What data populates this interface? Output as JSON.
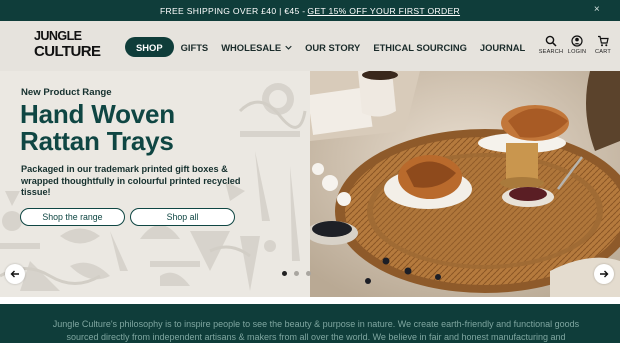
{
  "announcement": {
    "text": "FREE SHIPPING OVER £40 | €45 - ",
    "link": "GET 15% OFF YOUR FIRST ORDER",
    "close_glyph": "×"
  },
  "brand": {
    "logo_line1": "JUNGLE",
    "logo_line2": "CULTURE"
  },
  "nav": {
    "items": [
      {
        "label": "SHOP"
      },
      {
        "label": "GIFTS"
      },
      {
        "label": "WHOLESALE"
      },
      {
        "label": "OUR STORY"
      },
      {
        "label": "ETHICAL SOURCING"
      },
      {
        "label": "JOURNAL"
      }
    ]
  },
  "tools": {
    "search": "SEARCH",
    "login": "LOGIN",
    "cart": "CART",
    "cart_count": "0"
  },
  "hero": {
    "eyebrow": "New Product Range",
    "headline_line1": "Hand Woven",
    "headline_line2": "Rattan Trays",
    "subtext": "Packaged in our trademark printed gift boxes & wrapped thoughtfully in colourful printed recycled tissue!",
    "cta_primary": "Shop the range",
    "cta_secondary": "Shop all",
    "slides_total": 3,
    "slide_active": 1
  },
  "philosophy": {
    "text": "Jungle Culture's philosophy is to inspire people to see the beauty & purpose in nature. We create earth-friendly and functional goods sourced directly from independent artisans & makers from all over the world. We believe in fair and honest manufacturing and"
  },
  "colors": {
    "brand_dark": "#0f3d3a",
    "headline": "#0f4643",
    "cream": "#ebe8e2"
  }
}
